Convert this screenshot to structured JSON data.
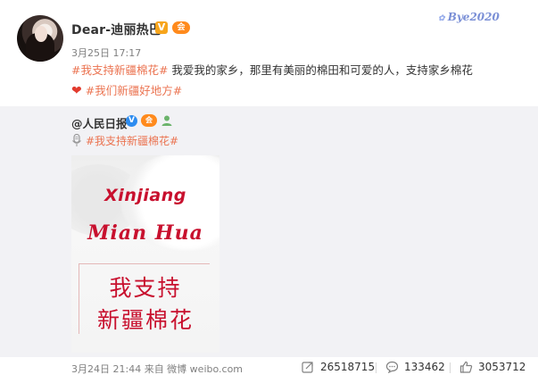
{
  "post": {
    "username": "Dear-迪丽热巴",
    "timestamp": "3月25日 17:17",
    "verified_badge": "V",
    "vip_badge": "会",
    "watermark": "Bye2020",
    "text_hashtag": "#我支持新疆棉花#",
    "text_body": " 我爱我的家乡，那里有美丽的棉田和可爱的人，支持家乡棉花",
    "heart": "❤",
    "second_hashtag": "#我们新疆好地方#"
  },
  "repost": {
    "author": "@人民日报",
    "verified_badge": "V",
    "vip_badge": "会",
    "hashtag": "#我支持新疆棉花#",
    "image": {
      "line1": "Xinjiang",
      "line2": "Mian Hua",
      "line3": "我支持",
      "line4": "新疆棉花"
    },
    "footer": "3月24日 21:44 来自 微博 weibo.com",
    "stats": {
      "reposts": "26518715",
      "comments": "133462",
      "likes": "3053712"
    }
  },
  "colors": {
    "hashtag": "#eb7350",
    "image_text": "#c8102e",
    "repost_bg": "#f2f2f5"
  }
}
